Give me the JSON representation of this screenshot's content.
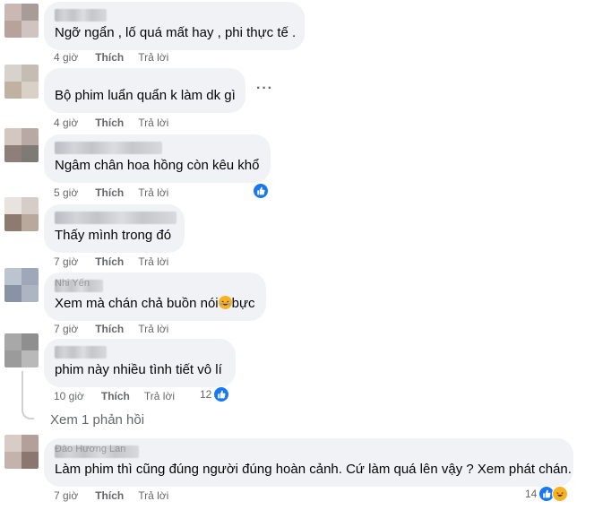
{
  "comments": [
    {
      "text": "Ngỡ ngẩn , lố quá mất hay , phi thực tế .",
      "time": "4 giờ",
      "like": "Thích",
      "reply": "Trả lời",
      "author_ghost": ""
    },
    {
      "text": "Bộ phim luẩn quẩn k làm dk gì",
      "time": "4 giờ",
      "like": "Thích",
      "reply": "Trả lời",
      "author_ghost": ""
    },
    {
      "text": "Ngâm chân hoa hồng còn kêu khổ",
      "time": "5 giờ",
      "like": "Thích",
      "reply": "Trả lời",
      "author_ghost": ""
    },
    {
      "text": "Thấy mình trong đó",
      "time": "7 giờ",
      "like": "Thích",
      "reply": "Trả lời",
      "author_ghost": ""
    },
    {
      "text_before": "Xem mà chán chả buồn nói",
      "text_after": "bực",
      "time": "7 giờ",
      "like": "Thích",
      "reply": "Trả lời",
      "author_ghost": "Nhi Yến"
    },
    {
      "text": "phim này nhiều tình tiết vô lí",
      "time": "10 giờ",
      "like": "Thích",
      "reply": "Trả lời",
      "reactions": "12",
      "author_ghost": ""
    },
    {
      "text": "Làm phim thì cũng đúng người đúng hoàn cảnh. Cứ làm quá lên vậy ? Xem phát chán.",
      "time": "7 giờ",
      "like": "Thích",
      "reply": "Trả lời",
      "reactions": "14",
      "author_ghost": "Đào Hương Lan"
    }
  ],
  "view_replies": "Xem 1 phản hồi",
  "more_menu": "···",
  "colors": {
    "bubble": "#f0f2f5",
    "meta_text": "#65676b",
    "like_blue": "#1877f2",
    "haha_yellow": "#f7b125"
  },
  "icons": [
    "like-reaction-icon",
    "haha-reaction-icon",
    "more-options-icon"
  ]
}
